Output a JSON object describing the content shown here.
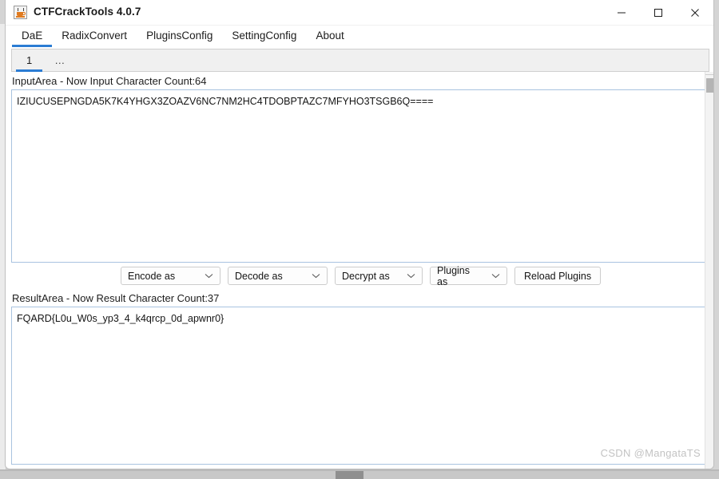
{
  "window": {
    "title": "CTFCrackTools 4.0.7",
    "app_icon": "java-coffee-cup-icon",
    "controls": {
      "minimize": "minimize-icon",
      "maximize": "maximize-icon",
      "close": "close-icon"
    }
  },
  "menubar": {
    "items": [
      {
        "label": "DaE",
        "active": true
      },
      {
        "label": "RadixConvert",
        "active": false
      },
      {
        "label": "PluginsConfig",
        "active": false
      },
      {
        "label": "SettingConfig",
        "active": false
      },
      {
        "label": "About",
        "active": false
      }
    ]
  },
  "tabstrip": {
    "tabs": [
      {
        "label": "1",
        "active": true
      },
      {
        "label": "…",
        "active": false
      }
    ]
  },
  "input_area": {
    "label": "InputArea - Now Input Character Count:64",
    "value": "IZIUCUSEPNGDA5K7K4YHGX3ZOAZV6NC7NM2HC4TDOBPTAZC7MFYHO3TSGB6Q====",
    "character_count": 64
  },
  "result_area": {
    "label": "ResultArea - Now Result Character Count:37",
    "value": "FQARD{L0u_W0s_yp3_4_k4qrcp_0d_apwnr0}",
    "character_count": 37
  },
  "toolbar": {
    "encode_label": "Encode as",
    "decode_label": "Decode as",
    "decrypt_label": "Decrypt as",
    "plugins_label": "Plugins as",
    "reload_label": "Reload Plugins",
    "chevron": "▾"
  },
  "watermark": {
    "text": "CSDN @MangataTS"
  },
  "colors": {
    "accent": "#2b7cd3",
    "field_border": "#a9c3e0",
    "window_border": "#bfbfbf",
    "watermark": "#c3c3c3"
  }
}
